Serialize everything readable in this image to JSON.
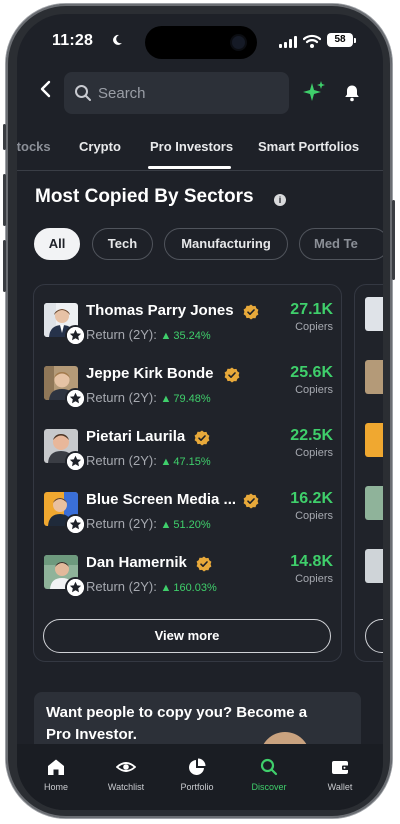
{
  "status": {
    "time": "11:28",
    "battery": "58"
  },
  "search": {
    "placeholder": "Search"
  },
  "tabs": [
    {
      "label": "Stocks"
    },
    {
      "label": "Crypto"
    },
    {
      "label": "Pro Investors"
    },
    {
      "label": "Smart Portfolios"
    }
  ],
  "section": {
    "title": "Most Copied By Sectors"
  },
  "chips": [
    {
      "label": "All"
    },
    {
      "label": "Tech"
    },
    {
      "label": "Manufacturing"
    },
    {
      "label": "Med Te"
    }
  ],
  "investors": [
    {
      "name": "Thomas Parry Jones",
      "return_label": "Return (2Y):",
      "return_value": "35.24%",
      "copiers_count": "27.1K",
      "copiers_label": "Copiers"
    },
    {
      "name": "Jeppe Kirk Bonde",
      "return_label": "Return (2Y):",
      "return_value": "79.48%",
      "copiers_count": "25.6K",
      "copiers_label": "Copiers"
    },
    {
      "name": "Pietari Laurila",
      "return_label": "Return (2Y):",
      "return_value": "47.15%",
      "copiers_count": "22.5K",
      "copiers_label": "Copiers"
    },
    {
      "name": "Blue Screen Media ...",
      "return_label": "Return (2Y):",
      "return_value": "51.20%",
      "copiers_count": "16.2K",
      "copiers_label": "Copiers"
    },
    {
      "name": "Dan Hamernik",
      "return_label": "Return (2Y):",
      "return_value": "160.03%",
      "copiers_count": "14.8K",
      "copiers_label": "Copiers"
    }
  ],
  "view_more": "View more",
  "promo": {
    "text": "Want people to copy you? Become a Pro Investor."
  },
  "bottom_nav": [
    {
      "label": "Home",
      "icon": "home-icon"
    },
    {
      "label": "Watchlist",
      "icon": "watchlist-icon"
    },
    {
      "label": "Portfolio",
      "icon": "pie-chart-icon"
    },
    {
      "label": "Discover",
      "icon": "search-icon"
    },
    {
      "label": "Wallet",
      "icon": "wallet-icon"
    }
  ],
  "colors": {
    "accent_green": "#3fcf6b",
    "background": "#1e2128",
    "verified_gold": "#e8a93a"
  }
}
